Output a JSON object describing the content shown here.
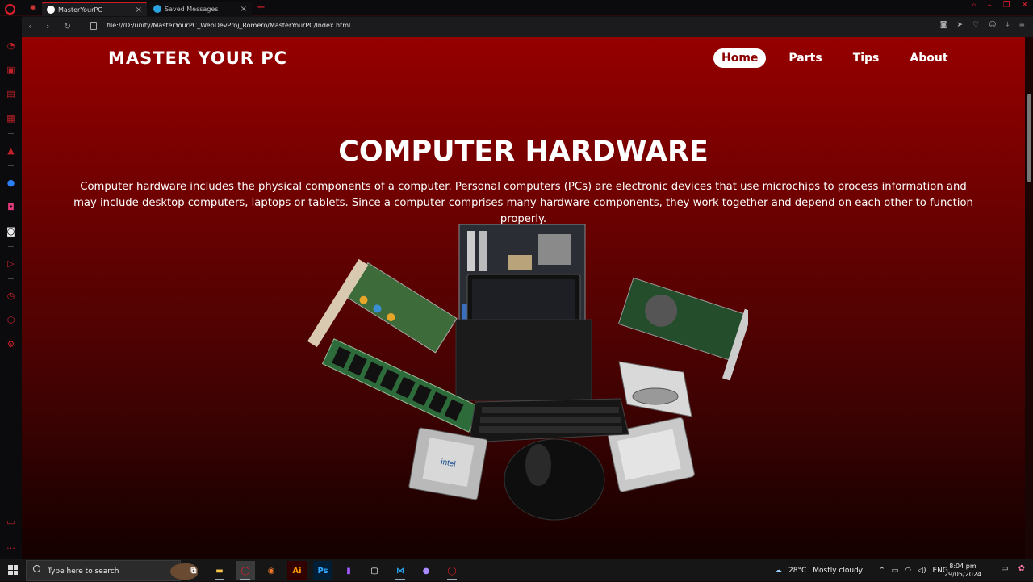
{
  "browser": {
    "tabs": [
      {
        "title": "MasterYourPC",
        "active": true
      },
      {
        "title": "Saved Messages",
        "active": false
      }
    ],
    "url": "file:///D:/unity/MasterYourPC_WebDevProj_Romero/MasterYourPC/Index.html"
  },
  "site": {
    "logo": "MASTER YOUR PC",
    "nav": [
      {
        "label": "Home",
        "active": true
      },
      {
        "label": "Parts",
        "active": false
      },
      {
        "label": "Tips",
        "active": false
      },
      {
        "label": "About",
        "active": false
      }
    ],
    "hero": {
      "title": "COMPUTER HARDWARE",
      "text": "Computer hardware includes the physical components of a computer. Personal computers (PCs) are electronic devices that use microchips to process information and may include desktop computers, laptops or tablets. Since a computer comprises many hardware components, they work together and depend on each other to function properly."
    },
    "brand_color": "#8b0000"
  },
  "taskbar": {
    "search_placeholder": "Type here to search",
    "weather": {
      "temp": "28°C",
      "condition": "Mostly cloudy"
    },
    "language": "ENG",
    "time": "8:04 pm",
    "date": "29/05/2024"
  }
}
